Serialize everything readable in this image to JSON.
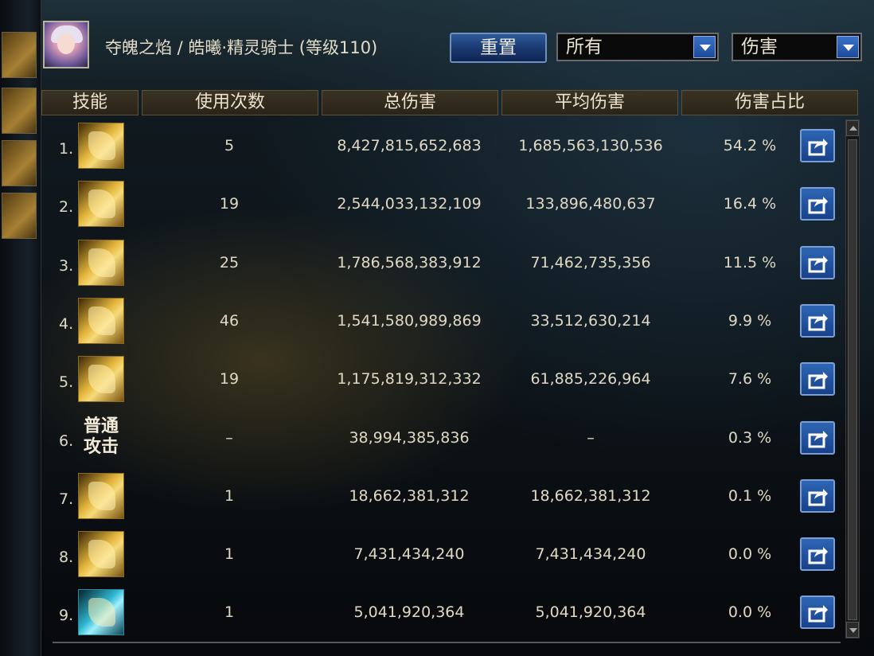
{
  "title": "夺魄之焰 / 皓曦·精灵骑士 (等级110)",
  "reset_label": "重置",
  "filter_all": "所有",
  "filter_metric": "伤害",
  "headers": {
    "skill": "技能",
    "count": "使用次数",
    "total": "总伤害",
    "avg": "平均伤害",
    "pct": "伤害占比"
  },
  "rows": [
    {
      "rank": "1.",
      "count": "5",
      "total": "8,427,815,652,683",
      "avg": "1,685,563,130,536",
      "pct": "54.2 %"
    },
    {
      "rank": "2.",
      "count": "19",
      "total": "2,544,033,132,109",
      "avg": "133,896,480,637",
      "pct": "16.4 %"
    },
    {
      "rank": "3.",
      "count": "25",
      "total": "1,786,568,383,912",
      "avg": "71,462,735,356",
      "pct": "11.5 %"
    },
    {
      "rank": "4.",
      "count": "46",
      "total": "1,541,580,989,869",
      "avg": "33,512,630,214",
      "pct": "9.9 %"
    },
    {
      "rank": "5.",
      "count": "19",
      "total": "1,175,819,312,332",
      "avg": "61,885,226,964",
      "pct": "7.6 %"
    },
    {
      "rank": "6.",
      "count": "–",
      "total": "38,994,385,836",
      "avg": "–",
      "pct": "0.3 %",
      "icon_text": "普通攻击"
    },
    {
      "rank": "7.",
      "count": "1",
      "total": "18,662,381,312",
      "avg": "18,662,381,312",
      "pct": "0.1 %"
    },
    {
      "rank": "8.",
      "count": "1",
      "total": "7,431,434,240",
      "avg": "7,431,434,240",
      "pct": "0.0 %"
    },
    {
      "rank": "9.",
      "count": "1",
      "total": "5,041,920,364",
      "avg": "5,041,920,364",
      "pct": "0.0 %"
    }
  ],
  "icons": [
    "share-icon",
    "dropdown-arrow-icon",
    "scroll-up-icon",
    "scroll-down-icon"
  ],
  "accent_color": "#1e4a98",
  "pct_unit_note": "%"
}
